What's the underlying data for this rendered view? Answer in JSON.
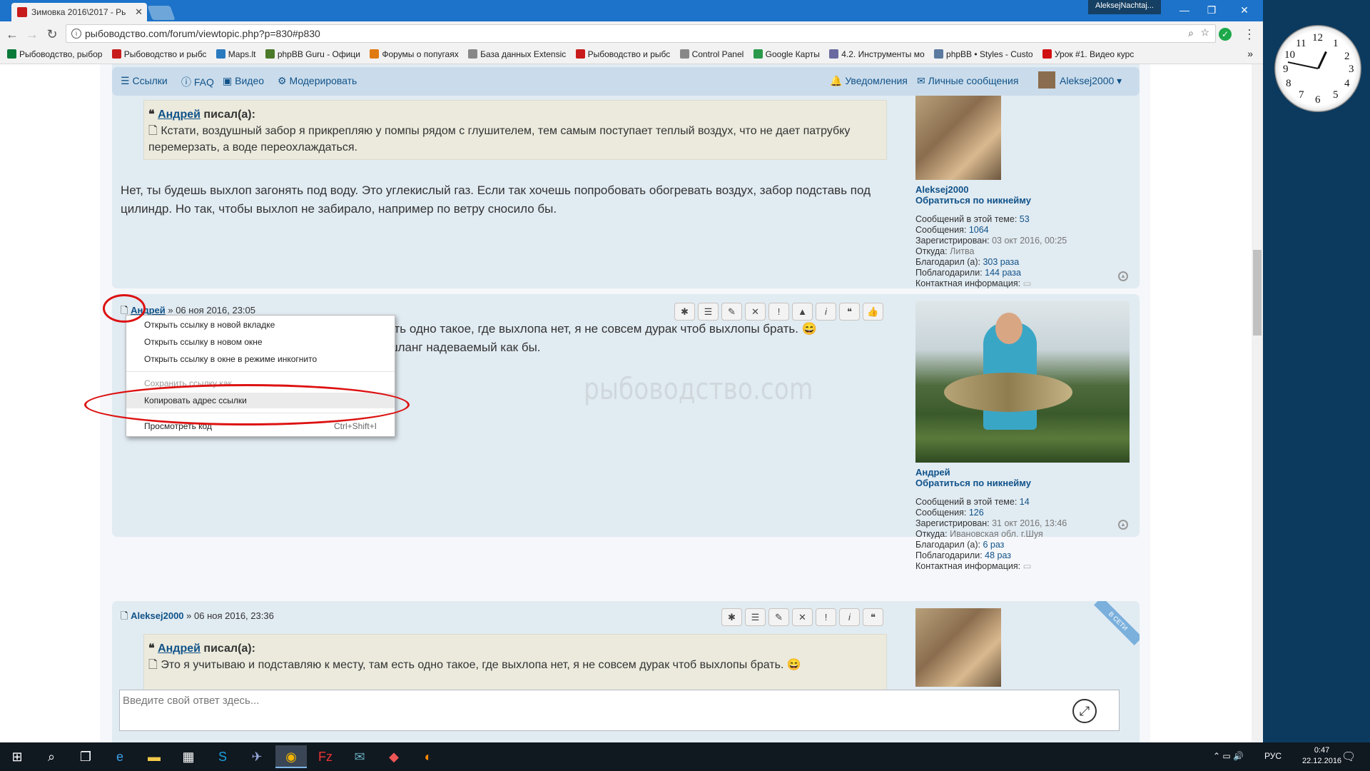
{
  "browser": {
    "tab_title": "Зимовка 2016\\2017 - Рь",
    "window_user": "AleksejNachtaj...",
    "url": "рыбоводство.com/forum/viewtopic.php?p=830#p830",
    "bookmarks": [
      {
        "label": "Рыбоводство, рыбор",
        "color": "#0a7a3a"
      },
      {
        "label": "Рыбоводство и рыбс",
        "color": "#c81c1c"
      },
      {
        "label": "Maps.lt",
        "color": "#2a7ac0"
      },
      {
        "label": "phpBB Guru - Офици",
        "color": "#4a7a2a"
      },
      {
        "label": "Форумы о попугаях",
        "color": "#e07a10"
      },
      {
        "label": "База данных Extensic",
        "color": "#888888"
      },
      {
        "label": "Рыбоводство и рыбс",
        "color": "#c81c1c"
      },
      {
        "label": "Control Panel",
        "color": "#888888"
      },
      {
        "label": "Google Карты",
        "color": "#2a9a4a"
      },
      {
        "label": "4.2. Инструменты мо",
        "color": "#6a6aa0"
      },
      {
        "label": "phpBB • Styles - Custo",
        "color": "#5a7aa0"
      },
      {
        "label": "Урок #1. Видео курс",
        "color": "#d01010"
      }
    ]
  },
  "navbar": {
    "links": "Ссылки",
    "faq": "FAQ",
    "video": "Видео",
    "moderate": "Модерировать",
    "notifications": "Уведомления",
    "messages": "Личные сообщения",
    "user": "Aleksej2000 ▾"
  },
  "post1": {
    "quote_author": "Андрей",
    "quote_wrote": "писал(а):",
    "quote_text": "Кстати, воздушный забор я прикрепляю у помпы рядом с глушителем, тем самым поступает теплый воздух, что не дает патрубку перемерзать, а воде переохлаждаться.",
    "text": "Нет, ты будешь выхлоп загонять под воду. Это углекислый газ. Если так хочешь попробовать обогревать воздух, забор подставь под цилиндр. Но так, чтобы выхлоп не забирало, например по ветру сносило бы.",
    "profile": {
      "username": "Aleksej2000",
      "mention": "Обратиться по никнейму",
      "posts_topic_label": "Сообщений в этой теме:",
      "posts_topic": "53",
      "posts_label": "Сообщения:",
      "posts": "1064",
      "registered_label": "Зарегистрирован:",
      "registered": "03 окт 2016, 00:25",
      "from_label": "Откуда:",
      "from": "Литва",
      "thanked_label": "Благодарил (а):",
      "thanked": "303 раза",
      "thanks_label": "Поблагодарили:",
      "thanks": "144 раза",
      "contact_label": "Контактная информация:"
    }
  },
  "post2": {
    "author": "Андрей",
    "date": "» 06 ноя 2016, 23:05",
    "text_line1": "сть одно такое, где выхлопа нет, я не совсем дурак чтоб выхлопы брать. 😄",
    "text_line2": "шланг надеваемый как бы.",
    "watermark": "рыбоводство.com",
    "profile": {
      "username": "Андрей",
      "mention": "Обратиться по никнейму",
      "posts_topic_label": "Сообщений в этой теме:",
      "posts_topic": "14",
      "posts_label": "Сообщения:",
      "posts": "126",
      "registered_label": "Зарегистрирован:",
      "registered": "31 окт 2016, 13:46",
      "from_label": "Откуда:",
      "from": "Ивановская обл. г.Шуя",
      "thanked_label": "Благодарил (а):",
      "thanked": "6 раз",
      "thanks_label": "Поблагодарили:",
      "thanks": "48 раз",
      "contact_label": "Контактная информация:"
    }
  },
  "post3": {
    "author": "Aleksej2000",
    "date": "» 06 ноя 2016, 23:36",
    "online": "В СЕТИ",
    "quote_author": "Андрей",
    "quote_wrote": "писал(а):",
    "quote_text": "Это я учитываю и подставляю к месту, там есть одно такое, где выхлопа нет, я не совсем дурак чтоб выхлопы брать. 😄"
  },
  "context_menu": {
    "open_new_tab": "Открыть ссылку в новой вкладке",
    "open_new_window": "Открыть ссылку в новом окне",
    "open_incognito": "Открыть ссылку в окне в режиме инкогнито",
    "save_link": "Сохранить ссылку как...",
    "copy_link": "Копировать адрес ссылки",
    "inspect": "Просмотреть код",
    "inspect_shortcut": "Ctrl+Shift+I"
  },
  "reply": {
    "placeholder": "Введите свой ответ здесь..."
  },
  "taskbar": {
    "lang": "РУС",
    "time": "0:47",
    "date": "22.12.2016"
  },
  "gadget_clock": {
    "numbers": [
      "12",
      "1",
      "2",
      "3",
      "4",
      "5",
      "6",
      "7",
      "8",
      "9",
      "10",
      "11"
    ]
  }
}
